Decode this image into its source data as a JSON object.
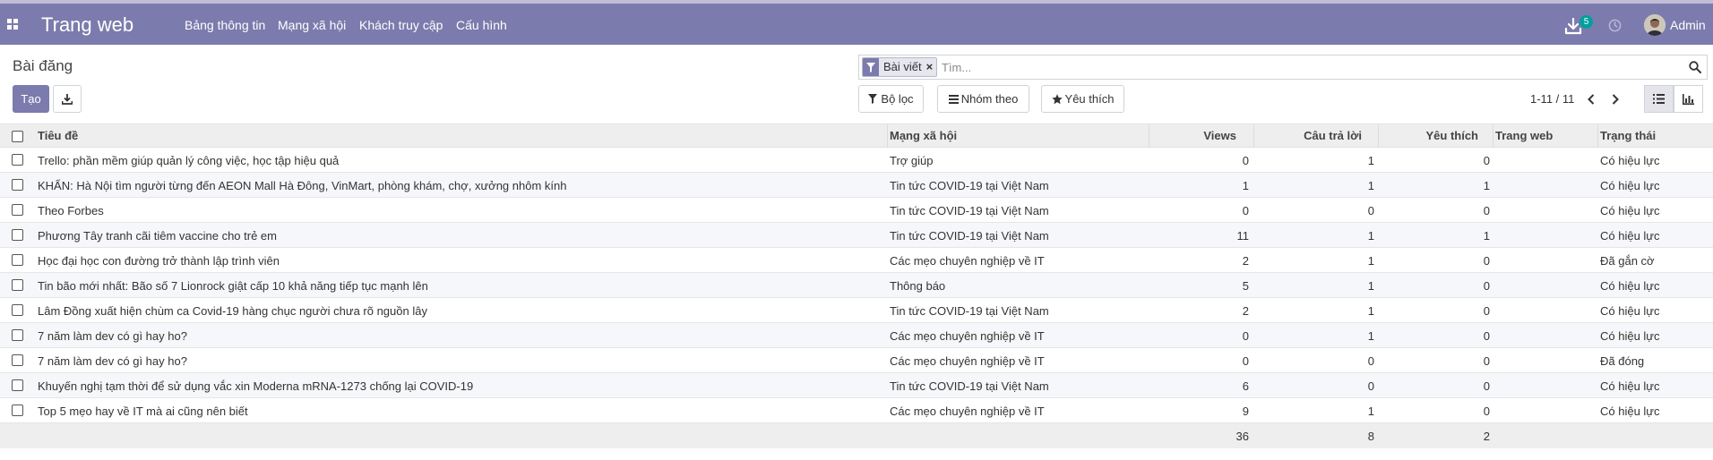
{
  "navbar": {
    "brand": "Trang web",
    "menu": [
      "Bảng thông tin",
      "Mạng xã hội",
      "Khách truy cập",
      "Cấu hình"
    ],
    "download_badge": "5",
    "user_name": "Admin",
    "bg_color": "#7c7bad",
    "icons": [
      "apps-grid-icon",
      "download-icon",
      "clock-icon",
      "user-avatar"
    ]
  },
  "control": {
    "page_title": "Bài đăng",
    "create_label": "Tạo",
    "download_icon": "download-icon",
    "filter_label": "Bộ lọc",
    "groupby_label": "Nhóm theo",
    "favorites_label": "Yêu thích",
    "pager_value": "1-11 / 11",
    "view_list_icon": "list-view-icon",
    "view_graph_icon": "graph-view-icon"
  },
  "search": {
    "facet_label": "Bài viết",
    "facet_icon": "filter-icon",
    "placeholder": "Tìm...",
    "value": ""
  },
  "table": {
    "headers": [
      "Tiêu đề",
      "Mạng xã hội",
      "Views",
      "Câu trả lời",
      "Yêu thích",
      "Trang web",
      "Trạng thái"
    ],
    "rows": [
      {
        "title": "Trello: phần mềm giúp quản lý công việc, học tập hiệu quả",
        "network": "Trợ giúp",
        "views": "0",
        "answers": "1",
        "favorites": "0",
        "website": "",
        "status": "Có hiệu lực"
      },
      {
        "title": "KHẨN: Hà Nội tìm người từng đến AEON Mall Hà Đông, VinMart, phòng khám, chợ, xưởng nhôm kính",
        "network": "Tin tức COVID-19 tại Việt Nam",
        "views": "1",
        "answers": "1",
        "favorites": "1",
        "website": "",
        "status": "Có hiệu lực"
      },
      {
        "title": "Theo Forbes",
        "network": "Tin tức COVID-19 tại Việt Nam",
        "views": "0",
        "answers": "0",
        "favorites": "0",
        "website": "",
        "status": "Có hiệu lực"
      },
      {
        "title": "Phương Tây tranh cãi tiêm vaccine cho trẻ em",
        "network": "Tin tức COVID-19 tại Việt Nam",
        "views": "11",
        "answers": "1",
        "favorites": "1",
        "website": "",
        "status": "Có hiệu lực"
      },
      {
        "title": "Học đại học con đường trở thành lập trình viên",
        "network": "Các mẹo chuyên nghiệp về IT",
        "views": "2",
        "answers": "1",
        "favorites": "0",
        "website": "",
        "status": "Đã gắn cờ"
      },
      {
        "title": "Tin bão mới nhất: Bão số 7 Lionrock giật cấp 10 khả năng tiếp tục mạnh lên",
        "network": "Thông báo",
        "views": "5",
        "answers": "1",
        "favorites": "0",
        "website": "",
        "status": "Có hiệu lực"
      },
      {
        "title": "Lâm Đồng xuất hiện chùm ca Covid-19 hàng chục người chưa rõ nguồn lây",
        "network": "Tin tức COVID-19 tại Việt Nam",
        "views": "2",
        "answers": "1",
        "favorites": "0",
        "website": "",
        "status": "Có hiệu lực"
      },
      {
        "title": "7 năm làm dev có gì hay ho?",
        "network": "Các mẹo chuyên nghiệp về IT",
        "views": "0",
        "answers": "1",
        "favorites": "0",
        "website": "",
        "status": "Có hiệu lực"
      },
      {
        "title": "7 năm làm dev có gì hay ho?",
        "network": "Các mẹo chuyên nghiệp về IT",
        "views": "0",
        "answers": "0",
        "favorites": "0",
        "website": "",
        "status": "Đã đóng"
      },
      {
        "title": "Khuyến nghị tạm thời để sử dụng vắc xin Moderna mRNA-1273 chống lại COVID-19",
        "network": "Tin tức COVID-19 tại Việt Nam",
        "views": "6",
        "answers": "0",
        "favorites": "0",
        "website": "",
        "status": "Có hiệu lực"
      },
      {
        "title": "Top 5 mẹo hay về IT mà ai cũng nên biết",
        "network": "Các mẹo chuyên nghiệp về IT",
        "views": "9",
        "answers": "1",
        "favorites": "0",
        "website": "",
        "status": "Có hiệu lực"
      }
    ],
    "totals": {
      "views": "36",
      "answers": "8",
      "favorites": "2"
    }
  }
}
